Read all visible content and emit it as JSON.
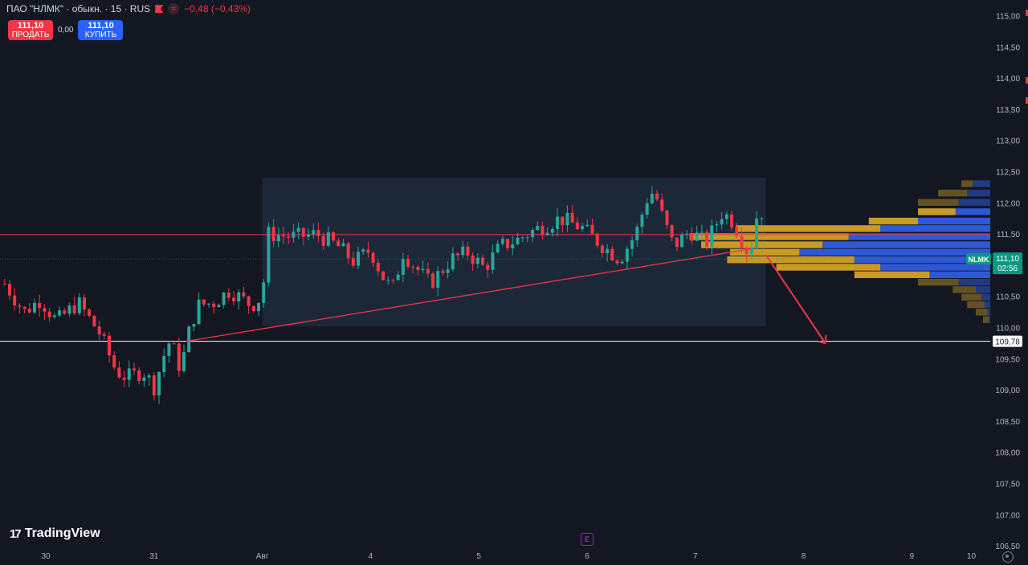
{
  "legend": {
    "title": "ПАО \"НЛМК\" · обыкн. · 15 · RUS",
    "change": "−0,48 (−0,43%)"
  },
  "trade": {
    "sell_price": "111,10",
    "sell_label": "ПРОДАТЬ",
    "spread": "0,00",
    "buy_price": "111,10",
    "buy_label": "КУПИТЬ"
  },
  "brand": {
    "name": "TradingView"
  },
  "earnings_marker": "E",
  "colors": {
    "background": "#131722",
    "up": "#26a69a",
    "down": "#f23645",
    "resistance_line": "#f23645",
    "support_line": "#ffffff",
    "range_box": "#1f2a3c",
    "volume_profile_up": "#2e58d6",
    "volume_profile_down": "#c99a24",
    "badge": "#089981"
  },
  "chart_data": {
    "type": "candlestick",
    "symbol": "NLMK",
    "timeframe": "15",
    "x_tick_labels": [
      "30",
      "31",
      "Авг",
      "4",
      "5",
      "6",
      "7",
      "8",
      "9",
      "10"
    ],
    "y_tick_labels": [
      "115,00",
      "114,50",
      "114,00",
      "113,50",
      "113,00",
      "112,50",
      "112,00",
      "111,50",
      "111,00",
      "110,50",
      "110,00",
      "109,50",
      "109,00",
      "108,50",
      "108,00",
      "107,50",
      "107,00",
      "106,50"
    ],
    "ylim": [
      106.5,
      115.0
    ],
    "last_price": 111.1,
    "last_price_label": "111,10",
    "countdown": "02:56",
    "symbol_badge": "NLMK",
    "support_level": 109.78,
    "support_label": "109,78",
    "resistance_level": 111.49,
    "range_box": {
      "day_start": 2.0,
      "day_end": 6.65,
      "price_low": 110.02,
      "price_high": 112.4
    },
    "trendline": [
      {
        "day": 1.3,
        "price": 109.78
      },
      {
        "day": 6.65,
        "price": 111.3
      }
    ],
    "arrow": [
      {
        "day": 6.65,
        "price": 111.17
      },
      {
        "day": 7.2,
        "price": 109.75
      }
    ],
    "price_path": [
      [
        -0.38,
        110.7
      ],
      [
        -0.2,
        110.25
      ],
      [
        -0.05,
        110.45
      ],
      [
        0.1,
        110.1
      ],
      [
        0.3,
        110.4
      ],
      [
        0.5,
        109.9
      ],
      [
        0.65,
        109.3
      ],
      [
        0.75,
        109.2
      ],
      [
        0.9,
        109.3
      ],
      [
        1.0,
        109.05
      ],
      [
        1.1,
        109.6
      ],
      [
        1.15,
        109.8
      ],
      [
        1.25,
        109.3
      ],
      [
        1.3,
        109.8
      ],
      [
        1.4,
        110.35
      ],
      [
        1.55,
        110.4
      ],
      [
        1.7,
        110.6
      ],
      [
        1.9,
        110.35
      ],
      [
        2.0,
        110.5
      ],
      [
        2.05,
        111.5
      ],
      [
        2.3,
        111.45
      ],
      [
        2.5,
        111.5
      ],
      [
        2.7,
        111.3
      ],
      [
        2.85,
        111.05
      ],
      [
        3.0,
        111.25
      ],
      [
        3.1,
        110.85
      ],
      [
        3.2,
        110.6
      ],
      [
        3.3,
        111.2
      ],
      [
        3.45,
        110.9
      ],
      [
        3.55,
        110.7
      ],
      [
        3.75,
        111.1
      ],
      [
        3.9,
        111.2
      ],
      [
        4.05,
        110.95
      ],
      [
        4.2,
        111.3
      ],
      [
        4.35,
        111.4
      ],
      [
        4.5,
        111.55
      ],
      [
        4.75,
        111.75
      ],
      [
        4.95,
        111.6
      ],
      [
        5.15,
        111.3
      ],
      [
        5.3,
        111.1
      ],
      [
        5.45,
        111.5
      ],
      [
        5.55,
        112.05
      ],
      [
        5.62,
        112.2
      ],
      [
        5.7,
        111.75
      ],
      [
        5.8,
        111.3
      ],
      [
        5.95,
        111.55
      ],
      [
        6.1,
        111.35
      ],
      [
        6.25,
        111.85
      ],
      [
        6.35,
        111.7
      ],
      [
        6.5,
        111.15
      ],
      [
        6.6,
        112.1
      ],
      [
        6.65,
        111.1
      ]
    ],
    "volume_profile": [
      {
        "price": 112.3,
        "up": 0.06,
        "down": 0.04
      },
      {
        "price": 112.15,
        "up": 0.08,
        "down": 0.1
      },
      {
        "price": 112.0,
        "up": 0.11,
        "down": 0.14
      },
      {
        "price": 111.85,
        "up": 0.12,
        "down": 0.13
      },
      {
        "price": 111.7,
        "up": 0.25,
        "down": 0.17
      },
      {
        "price": 111.58,
        "up": 0.38,
        "down": 0.5
      },
      {
        "price": 111.45,
        "up": 0.49,
        "down": 0.55
      },
      {
        "price": 111.32,
        "up": 0.58,
        "down": 0.42
      },
      {
        "price": 111.2,
        "up": 0.66,
        "down": 0.24
      },
      {
        "price": 111.08,
        "up": 0.47,
        "down": 0.44
      },
      {
        "price": 110.96,
        "up": 0.38,
        "down": 0.36
      },
      {
        "price": 110.84,
        "up": 0.21,
        "down": 0.26
      },
      {
        "price": 110.72,
        "up": 0.11,
        "down": 0.14
      },
      {
        "price": 110.6,
        "up": 0.05,
        "down": 0.08
      },
      {
        "price": 110.48,
        "up": 0.03,
        "down": 0.07
      },
      {
        "price": 110.36,
        "up": 0.02,
        "down": 0.06
      },
      {
        "price": 110.24,
        "up": 0.01,
        "down": 0.04
      },
      {
        "price": 110.12,
        "up": 0.005,
        "down": 0.02
      }
    ]
  }
}
